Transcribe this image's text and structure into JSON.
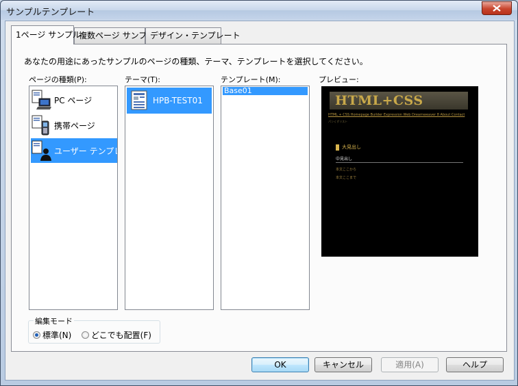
{
  "window": {
    "title": "サンプルテンプレート"
  },
  "tabs": [
    {
      "label": "1ページ サンプル"
    },
    {
      "label": "複数ページ サンプル"
    },
    {
      "label": "デザイン・テンプレート"
    }
  ],
  "instruction": "あなたの用途にあったサンプルのページの種類、テーマ、テンプレートを選択してください。",
  "labels": {
    "page_type": "ページの種類(P):",
    "theme": "テーマ(T):",
    "template": "テンプレート(M):",
    "preview": "プレビュー:"
  },
  "page_types": [
    {
      "label": "PC ページ",
      "icon": "pc-page-icon"
    },
    {
      "label": "携帯ページ",
      "icon": "mobile-page-icon"
    },
    {
      "label": "ユーザー テンプレート",
      "icon": "user-template-icon",
      "selected": true
    }
  ],
  "themes": [
    {
      "label": "HPB-TEST01",
      "icon": "theme-document-icon",
      "selected": true
    }
  ],
  "templates": [
    {
      "label": "Base01",
      "selected": true
    }
  ],
  "preview": {
    "logo": "HTML+CSS",
    "nav": "HTML + CSS Homepage Builder Expression Web Dreamweaver 8 About Contact",
    "breadcrumb": "パンくずリスト",
    "heading1": "大見出し",
    "heading2": "中見出し",
    "text1": "本文ここから",
    "text2": "本文ここまで"
  },
  "edit_mode": {
    "label": "編集モード",
    "options": [
      {
        "label": "標準(N)",
        "selected": true
      },
      {
        "label": "どこでも配置(F)",
        "selected": false
      }
    ]
  },
  "buttons": {
    "ok": "OK",
    "cancel": "キャンセル",
    "apply": "適用(A)",
    "help": "ヘルプ"
  },
  "colors": {
    "selection": "#3399ff",
    "preview_bg": "#000000",
    "preview_gold": "#c9a94a"
  }
}
